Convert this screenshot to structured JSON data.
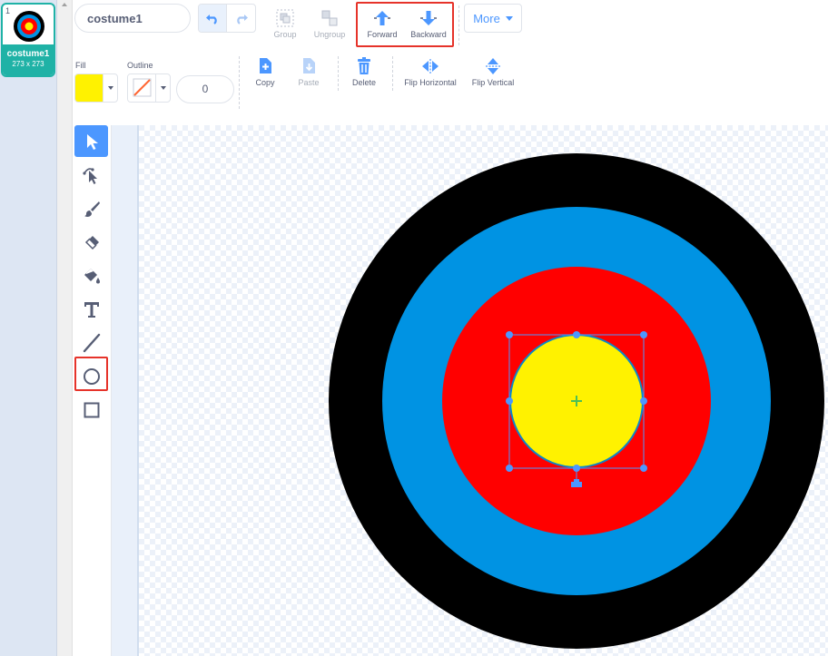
{
  "costume_list": {
    "index": "1",
    "name": "costume1",
    "size": "273 x 273"
  },
  "header": {
    "costume_name": "costume1",
    "group_label": "Group",
    "ungroup_label": "Ungroup",
    "forward_label": "Forward",
    "backward_label": "Backward",
    "more_label": "More"
  },
  "style": {
    "fill_label": "Fill",
    "outline_label": "Outline",
    "outline_width": "0",
    "fill_color": "#fff200"
  },
  "actions": {
    "copy_label": "Copy",
    "paste_label": "Paste",
    "delete_label": "Delete",
    "flip_horizontal_label": "Flip Horizontal",
    "flip_vertical_label": "Flip Vertical"
  },
  "tools": [
    {
      "name": "select-tool",
      "icon": "arrow-icon",
      "active": true
    },
    {
      "name": "reshape-tool",
      "icon": "reshape-icon"
    },
    {
      "name": "brush-tool",
      "icon": "brush-icon"
    },
    {
      "name": "eraser-tool",
      "icon": "eraser-icon"
    },
    {
      "name": "fill-tool",
      "icon": "bucket-icon"
    },
    {
      "name": "text-tool",
      "icon": "text-icon"
    },
    {
      "name": "line-tool",
      "icon": "line-icon"
    },
    {
      "name": "circle-tool",
      "icon": "circle-icon",
      "highlighted": true
    },
    {
      "name": "rectangle-tool",
      "icon": "rectangle-icon"
    }
  ],
  "colors": {
    "accent": "#4c97ff",
    "highlight": "#e6332a",
    "teal": "#1fb2a6",
    "target_outer": "#000000",
    "target_blue": "#0093e3",
    "target_red": "#ff0000",
    "target_center": "#fff200"
  }
}
